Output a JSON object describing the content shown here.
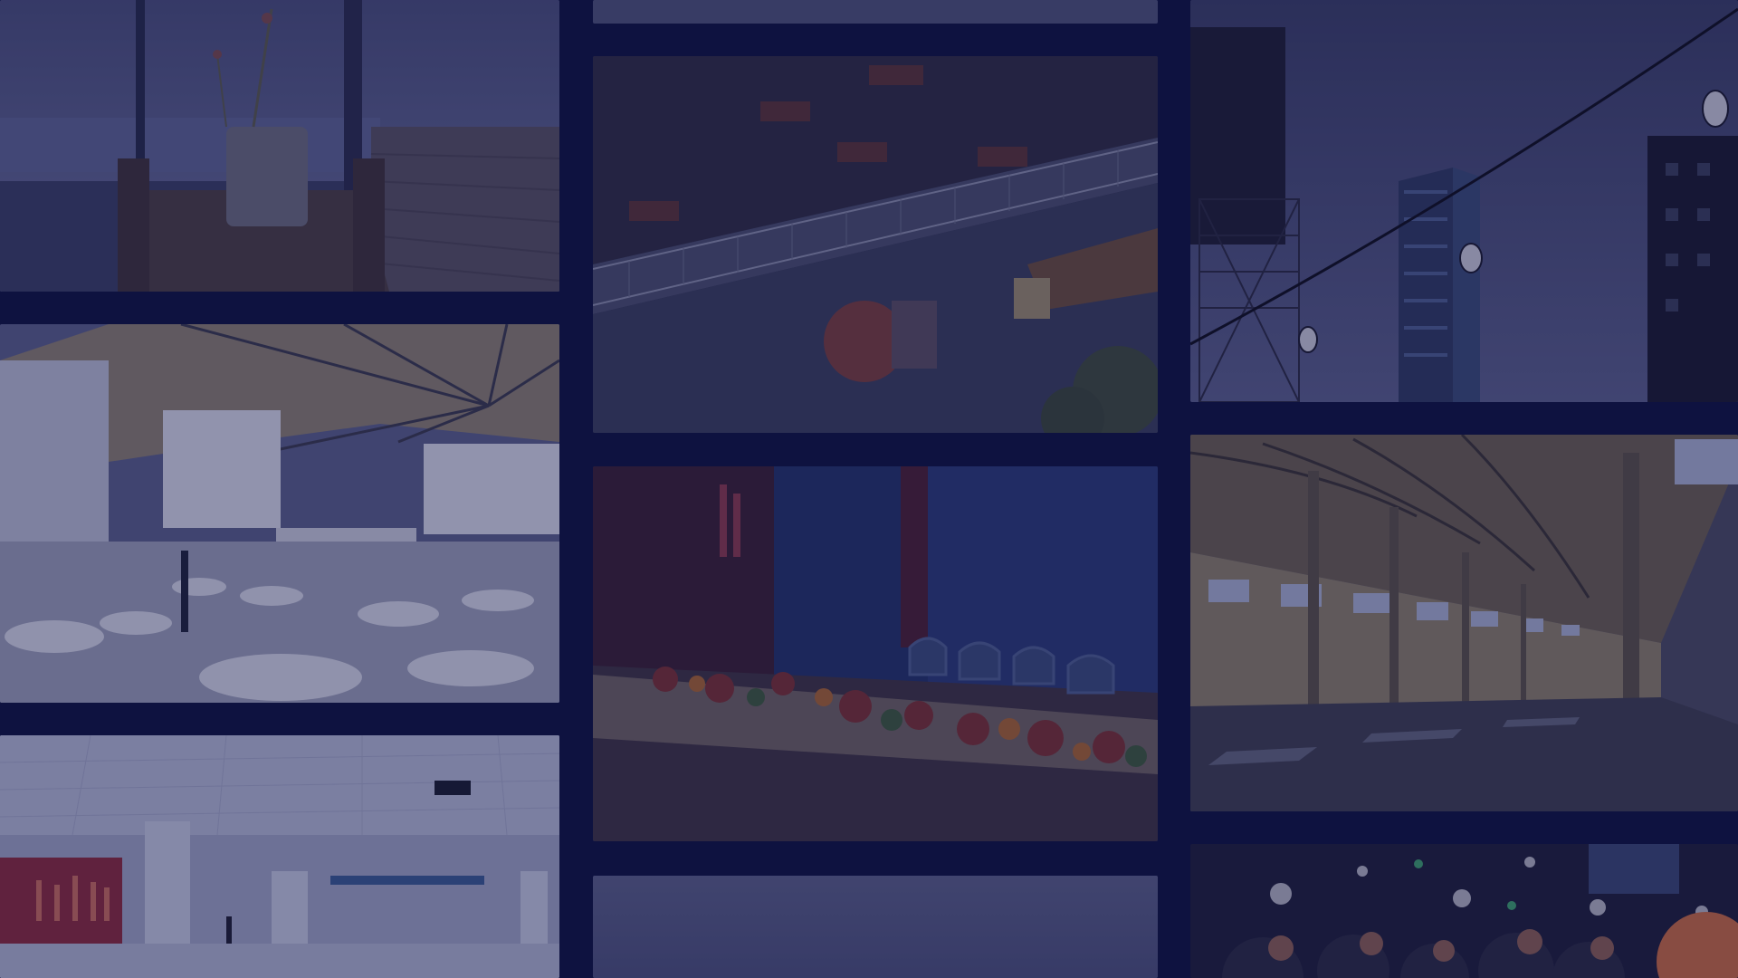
{
  "background_color": "#0e1240",
  "overlay_color": "#101448",
  "tiles": [
    {
      "name": "photo-waterfront-dining-room",
      "column": 1,
      "row": 1
    },
    {
      "name": "photo-conference-ballroom-screens",
      "column": 1,
      "row": 2
    },
    {
      "name": "photo-empty-exhibition-hall",
      "column": 1,
      "row": 3
    },
    {
      "name": "photo-top-strip-gray",
      "column": 2,
      "row": 0
    },
    {
      "name": "photo-overhead-restaurant-balcony",
      "column": 2,
      "row": 1
    },
    {
      "name": "photo-banquet-table-flowers",
      "column": 2,
      "row": 2
    },
    {
      "name": "photo-bottom-gray-sky",
      "column": 2,
      "row": 3
    },
    {
      "name": "photo-string-lights-city-dusk",
      "column": 3,
      "row": 1
    },
    {
      "name": "photo-industrial-warehouse-hall",
      "column": 3,
      "row": 2
    },
    {
      "name": "photo-party-crowd-lights",
      "column": 3,
      "row": 3
    }
  ]
}
